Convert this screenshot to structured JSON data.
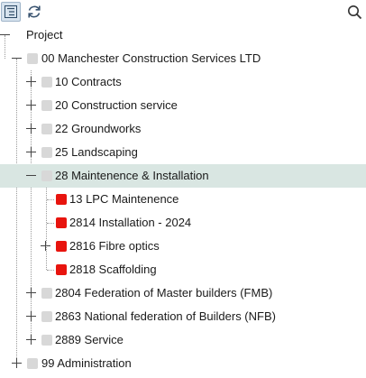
{
  "toolbar": {
    "tree_view_icon": "tree-list-icon",
    "refresh_icon": "refresh-icon",
    "search_icon": "search-icon"
  },
  "tree": {
    "root": {
      "label": "Project"
    },
    "company": {
      "label": "00 Manchester Construction Services LTD"
    },
    "items": [
      {
        "label": "10 Contracts",
        "expanded": false,
        "status_color": "#d8d8d8"
      },
      {
        "label": "20 Construction service",
        "expanded": false,
        "status_color": "#d8d8d8"
      },
      {
        "label": "22 Groundworks",
        "expanded": false,
        "status_color": "#d8d8d8"
      },
      {
        "label": "25 Landscaping",
        "expanded": false,
        "status_color": "#d8d8d8"
      },
      {
        "label": "28 Maintenence & Installation",
        "expanded": true,
        "selected": true,
        "status_color": "#d8d8d8"
      },
      {
        "label": "13 LPC Maintenence",
        "status_color": "#e8140e"
      },
      {
        "label": "2814 Installation - 2024",
        "status_color": "#e8140e"
      },
      {
        "label": "2816 Fibre optics",
        "expanded": false,
        "status_color": "#e8140e"
      },
      {
        "label": "2818 Scaffolding",
        "status_color": "#e8140e"
      },
      {
        "label": "2804 Federation of Master builders (FMB)",
        "expanded": false,
        "status_color": "#d8d8d8"
      },
      {
        "label": "2863 National federation of Builders (NFB)",
        "expanded": false,
        "status_color": "#d8d8d8"
      },
      {
        "label": "2889 Service",
        "expanded": false,
        "status_color": "#d8d8d8"
      }
    ],
    "admin": {
      "label": "99 Administration",
      "expanded": false
    }
  }
}
